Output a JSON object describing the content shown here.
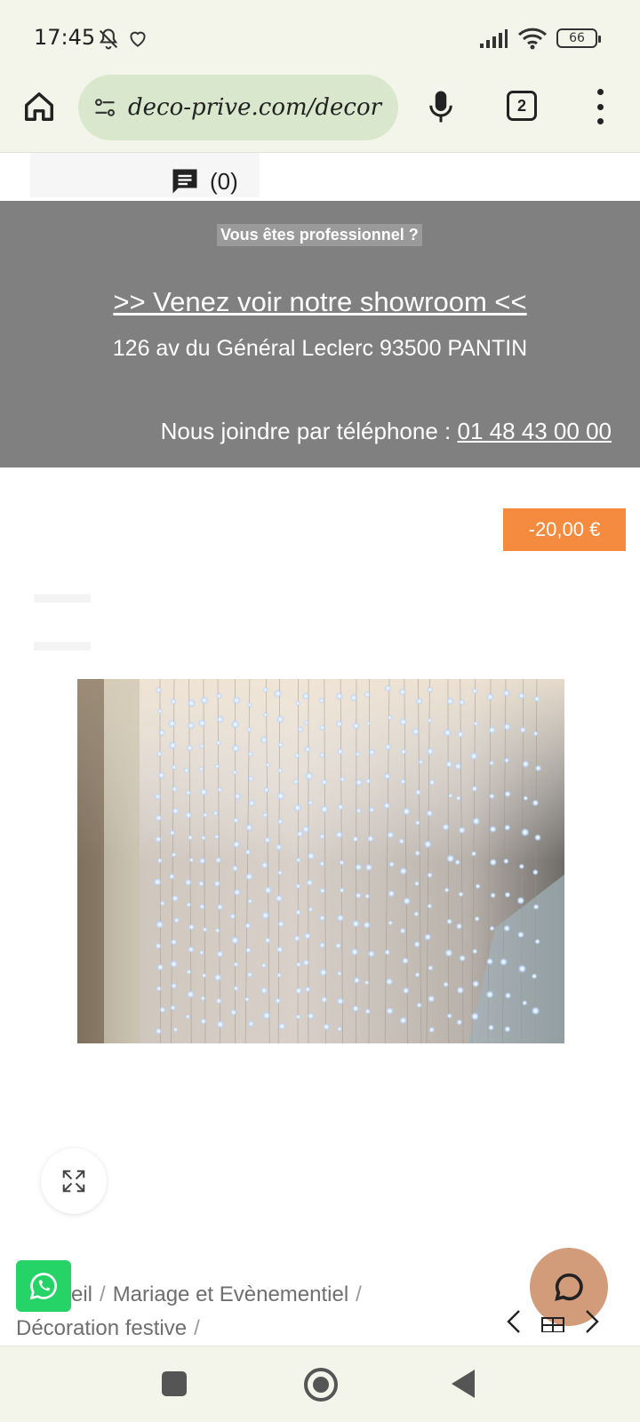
{
  "status_bar": {
    "time": "17:45",
    "battery": "66",
    "left_icons": [
      "bell-off-icon",
      "heart-icon"
    ],
    "right_icons": [
      "signal-icon",
      "wifi-icon",
      "battery-icon"
    ]
  },
  "browser": {
    "url": "deco-prive.com/decor",
    "tab_count": "2"
  },
  "page": {
    "comment_count": "(0)",
    "banner": {
      "pro_label": "Vous êtes professionnel ?",
      "showroom_link": ">> Venez voir notre showroom <<",
      "address": "126 av du Général Leclerc 93500 PANTIN",
      "phone_label": "Nous joindre par téléphone :",
      "phone_number": "01 48 43 00 00"
    },
    "discount": "-20,00 €",
    "breadcrumb": {
      "item1": "eil",
      "item2": "Mariage et Evènementiel",
      "item3": "Décoration festive",
      "separator": "/"
    }
  },
  "colors": {
    "browser_bg": "#f4f5ea",
    "url_pill": "#d9e7cc",
    "banner_bg": "#808080",
    "discount_badge": "#f58b3f",
    "whatsapp": "#25d366",
    "chat_button": "#d29b79"
  }
}
